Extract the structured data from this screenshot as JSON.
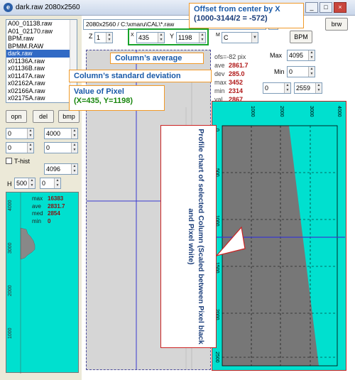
{
  "window": {
    "title": "dark.raw 2080x2560",
    "icon": "app-globe-icon",
    "buttons": [
      "_",
      "□",
      "×"
    ]
  },
  "path": "2080x2560 / C:\\xmaru\\CAL\\*.raw",
  "files": [
    "A00_01138.raw",
    "A01_02170.raw",
    "BPM.raw",
    "BPMM.RAW",
    "dark.raw",
    "x01136A.raw",
    "x01136B.raw",
    "x01147A.raw",
    "x02162A.raw",
    "x02166A.raw",
    "x02175A.raw"
  ],
  "selected_file": "dark.raw",
  "left_buttons": {
    "open": "opn",
    "delete": "del",
    "bmp": "bmp"
  },
  "left_spinners": [
    "0",
    "4000",
    "0",
    "0",
    "4096",
    "500",
    "0"
  ],
  "left_labels": {
    "thist": "T-hist",
    "h": "H"
  },
  "histogram": {
    "axis_ticks": [
      "4000",
      "3000",
      "2000",
      "1000"
    ],
    "stats": [
      {
        "k": "max",
        "v": "16383"
      },
      {
        "k": "ave",
        "v": "2831.7"
      },
      {
        "k": "med",
        "v": "2854"
      },
      {
        "k": "min",
        "v": "0"
      }
    ]
  },
  "top_controls": {
    "z_label": "Z",
    "z_value": "1",
    "x_label": "X",
    "x_value": "435",
    "y_label": "Y",
    "y_value": "1198",
    "m_label": "M",
    "m_value": "C",
    "bpm": "BPM",
    "brw": "brw"
  },
  "right_controls": {
    "max_label": "Max",
    "max_value": "4095",
    "min_label": "Min",
    "min_value": "0",
    "range_low": "0",
    "range_high": "2559"
  },
  "column_stats": {
    "ofs": "ofs=-82 pix",
    "rows": [
      {
        "k": "ave",
        "v": "2861.7"
      },
      {
        "k": "dev",
        "v": "285.0"
      },
      {
        "k": "max",
        "v": "3452"
      },
      {
        "k": "min",
        "v": "2314"
      },
      {
        "k": "val",
        "v": "2867"
      }
    ]
  },
  "callouts": {
    "offset_l1": "Offset from center by X",
    "offset_l2": "(1000-3144/2  = -572)",
    "average": "Column’s average",
    "deviation": "Column’s standard deviation",
    "pixel_l1": "Value of Pixel",
    "pixel_l2": "(X=435,  Y=1198)",
    "profile": "Profile chart of selected Column (Scaled between Pixel black and Pixel white)"
  },
  "profile_chart": {
    "x_ticks": [
      "1000",
      "2000",
      "3000",
      "4000"
    ],
    "y_ticks": [
      "0",
      "500",
      "1000",
      "1500",
      "2000",
      "2500"
    ]
  },
  "colors": {
    "accent": "#316ac5",
    "chart_bg": "#00e0cf",
    "callout_border": "#f09a2a",
    "value_red": "#b01818",
    "profile_border": "#cc2222"
  }
}
